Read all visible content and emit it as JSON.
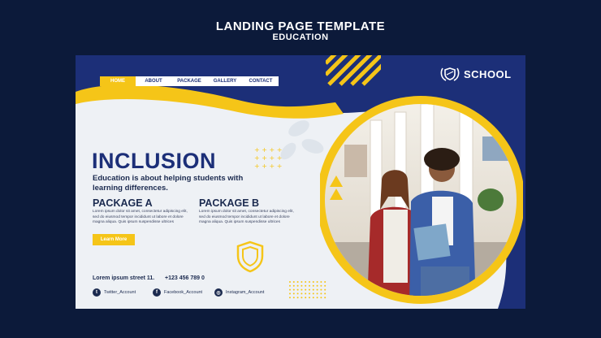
{
  "header": {
    "title": "LANDING PAGE TEMPLATE",
    "subtitle": "EDUCATION"
  },
  "nav": {
    "items": [
      "HOME",
      "ABOUT",
      "PACKAGE",
      "GALLERY",
      "CONTACT"
    ],
    "active": "HOME"
  },
  "brand": {
    "name": "SCHOOL",
    "icon": "shield-laurel-icon"
  },
  "hero": {
    "heading": "INCLUSION",
    "subtitle": "Education is about helping students with learning differences."
  },
  "packages": [
    {
      "title": "PACKAGE A",
      "text": "Lorem ipsum dolor sit amet, consectetur adipiscing elit, sed do eiusmod tempor incididunt ut labore et dolore magna aliqua. Quis ipsum suspendisse ultrices"
    },
    {
      "title": "PACKAGE B",
      "text": "Lorem ipsum dolor sit amet, consectetur adipiscing elit, sed do eiusmod tempor incididunt ut labore et dolore magna aliqua. Quis ipsum suspendisse ultrices"
    }
  ],
  "cta": {
    "label": "Learn More"
  },
  "contact": {
    "address": "Lorem ipsum street 11.",
    "phone": "+123 456 789 0"
  },
  "social": [
    {
      "icon": "twitter-icon",
      "glyph": "t",
      "label": "Twitter_Account"
    },
    {
      "icon": "facebook-icon",
      "glyph": "f",
      "label": "Facebook_Account"
    },
    {
      "icon": "instagram-icon",
      "glyph": "◎",
      "label": "Instagram_Account"
    }
  ],
  "colors": {
    "navy": "#1c2f78",
    "yellow": "#f5c518",
    "background": "#0c1a3a"
  }
}
